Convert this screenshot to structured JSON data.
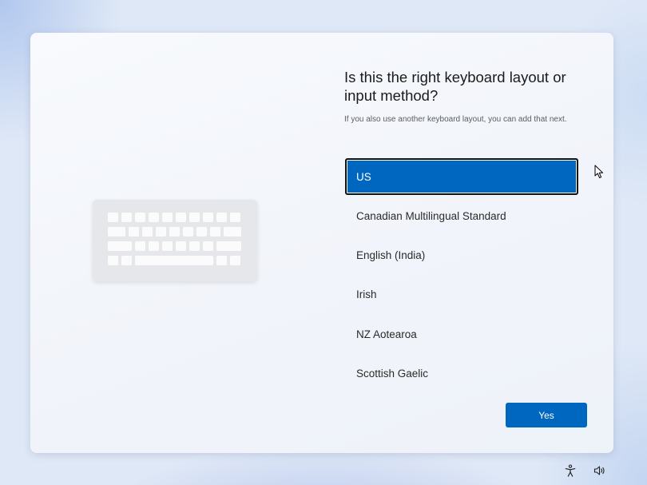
{
  "dialog": {
    "title": "Is this the right keyboard layout or input method?",
    "subtitle": "If you also use another keyboard layout, you can add that next."
  },
  "layouts": [
    {
      "label": "US",
      "selected": true
    },
    {
      "label": "Canadian Multilingual Standard",
      "selected": false
    },
    {
      "label": "English (India)",
      "selected": false
    },
    {
      "label": "Irish",
      "selected": false
    },
    {
      "label": "NZ Aotearoa",
      "selected": false
    },
    {
      "label": "Scottish Gaelic",
      "selected": false
    }
  ],
  "buttons": {
    "yes_label": "Yes"
  },
  "colors": {
    "accent": "#0067c0",
    "card_background": "#f5f7fb",
    "desktop_background": "#dfe8f6"
  },
  "icons": {
    "illustration": "keyboard-icon",
    "accessibility": "accessibility-icon",
    "volume": "volume-icon",
    "pointer": "mouse-pointer-icon"
  }
}
